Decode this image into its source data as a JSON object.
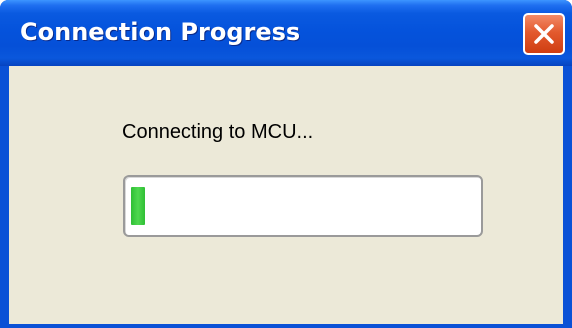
{
  "window": {
    "title": "Connection Progress"
  },
  "dialog": {
    "message": "Connecting to MCU...",
    "progress_fraction": 0.04
  },
  "colors": {
    "titlebar": "#0553dc",
    "client_background": "#ece9d8",
    "close_button": "#e35a2e",
    "progress_fill": "#33c43a"
  },
  "icons": {
    "close": "close-icon"
  }
}
